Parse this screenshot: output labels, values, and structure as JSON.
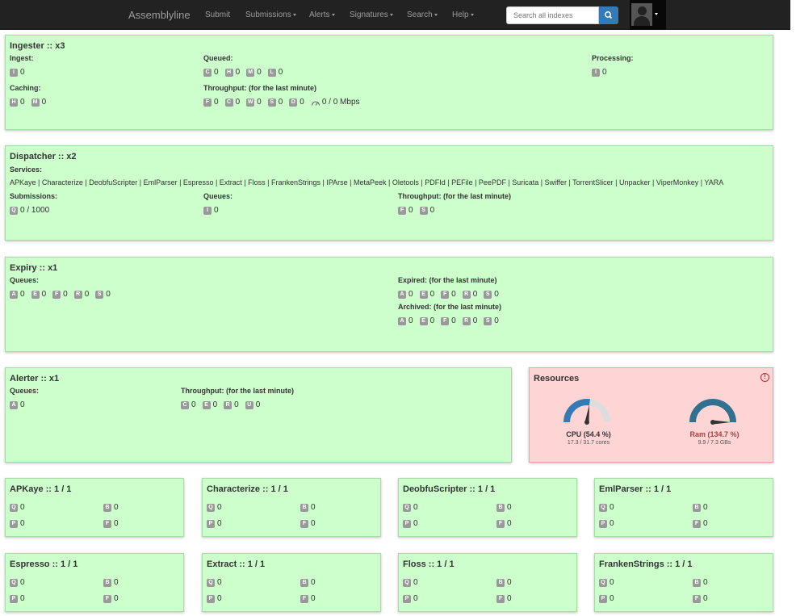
{
  "nav": {
    "brand": "Assemblyline",
    "items": [
      "Submit",
      "Submissions",
      "Alerts",
      "Signatures",
      "Search",
      "Help"
    ],
    "search_placeholder": "Search all indexes"
  },
  "ingester": {
    "title": "Ingester :: x3",
    "ingest_label": "Ingest:",
    "ingest": [
      {
        "b": "I",
        "v": "0"
      }
    ],
    "queued_label": "Queued:",
    "queued": [
      {
        "b": "C",
        "v": "0"
      },
      {
        "b": "H",
        "v": "0"
      },
      {
        "b": "M",
        "v": "0"
      },
      {
        "b": "L",
        "v": "0"
      }
    ],
    "processing_label": "Processing:",
    "processing": [
      {
        "b": "I",
        "v": "0"
      }
    ],
    "caching_label": "Caching:",
    "caching": [
      {
        "b": "H",
        "v": "0"
      },
      {
        "b": "M",
        "v": "0"
      }
    ],
    "throughput_label": "Throughput: (for the last minute)",
    "throughput": [
      {
        "b": "F",
        "v": "0"
      },
      {
        "b": "C",
        "v": "0"
      },
      {
        "b": "W",
        "v": "0"
      },
      {
        "b": "S",
        "v": "0"
      },
      {
        "b": "D",
        "v": "0"
      }
    ],
    "bandwidth": "0 / 0 Mbps"
  },
  "dispatcher": {
    "title": "Dispatcher :: x2",
    "services_label": "Services:",
    "services": "APKaye | Characterize | DeobfuScripter | EmlParser | Espresso | Extract | Floss | FrankenStrings | IPArse | MetaPeek | Oletools | PDFId | PEFile | PeePDF | Suricata | Swiffer | TorrentSlicer | Unpacker | ViperMonkey | YARA",
    "submissions_label": "Submissions:",
    "submissions": [
      {
        "b": "Q",
        "v": "0 / 1000"
      }
    ],
    "queues_label": "Queues:",
    "queues": [
      {
        "b": "I",
        "v": "0"
      }
    ],
    "throughput_label": "Throughput: (for the last minute)",
    "throughput": [
      {
        "b": "F",
        "v": "0"
      },
      {
        "b": "S",
        "v": "0"
      }
    ]
  },
  "expiry": {
    "title": "Expiry :: x1",
    "queues_label": "Queues:",
    "queues": [
      {
        "b": "A",
        "v": "0"
      },
      {
        "b": "E",
        "v": "0"
      },
      {
        "b": "F",
        "v": "0"
      },
      {
        "b": "R",
        "v": "0"
      },
      {
        "b": "S",
        "v": "0"
      }
    ],
    "expired_label": "Expired: (for the last minute)",
    "expired": [
      {
        "b": "A",
        "v": "0"
      },
      {
        "b": "E",
        "v": "0"
      },
      {
        "b": "F",
        "v": "0"
      },
      {
        "b": "R",
        "v": "0"
      },
      {
        "b": "S",
        "v": "0"
      }
    ],
    "archived_label": "Archived: (for the last minute)",
    "archived": [
      {
        "b": "A",
        "v": "0"
      },
      {
        "b": "E",
        "v": "0"
      },
      {
        "b": "F",
        "v": "0"
      },
      {
        "b": "R",
        "v": "0"
      },
      {
        "b": "S",
        "v": "0"
      }
    ]
  },
  "alerter": {
    "title": "Alerter :: x1",
    "queues_label": "Queues:",
    "queues": [
      {
        "b": "A",
        "v": "0"
      }
    ],
    "throughput_label": "Throughput: (for the last minute)",
    "throughput": [
      {
        "b": "C",
        "v": "0"
      },
      {
        "b": "E",
        "v": "0"
      },
      {
        "b": "R",
        "v": "0"
      },
      {
        "b": "U",
        "v": "0"
      }
    ]
  },
  "resources": {
    "title": "Resources",
    "cpu": {
      "label": "CPU (54.4 %)",
      "sub": "17.3 / 31.7 cores",
      "fraction": 0.544,
      "color": "#337ab7",
      "label_color": "#333333"
    },
    "ram": {
      "label": "Ram (134.7 %)",
      "sub": "9.9 / 7.3 GBs",
      "fraction": 1.0,
      "color": "#31708f",
      "label_color": "#a94442"
    }
  },
  "services": [
    {
      "title": "APKaye :: 1 / 1",
      "q": "0",
      "b": "0",
      "p": "0",
      "f": "0"
    },
    {
      "title": "Characterize :: 1 / 1",
      "q": "0",
      "b": "0",
      "p": "0",
      "f": "0"
    },
    {
      "title": "DeobfuScripter :: 1 / 1",
      "q": "0",
      "b": "0",
      "p": "0",
      "f": "0"
    },
    {
      "title": "EmlParser :: 1 / 1",
      "q": "0",
      "b": "0",
      "p": "0",
      "f": "0"
    },
    {
      "title": "Espresso :: 1 / 1",
      "q": "0",
      "b": "0",
      "p": "0",
      "f": "0"
    },
    {
      "title": "Extract :: 1 / 1",
      "q": "0",
      "b": "0",
      "p": "0",
      "f": "0"
    },
    {
      "title": "Floss :: 1 / 1",
      "q": "0",
      "b": "0",
      "p": "0",
      "f": "0"
    },
    {
      "title": "FrankenStrings :: 1 / 1",
      "q": "0",
      "b": "0",
      "p": "0",
      "f": "0"
    }
  ]
}
